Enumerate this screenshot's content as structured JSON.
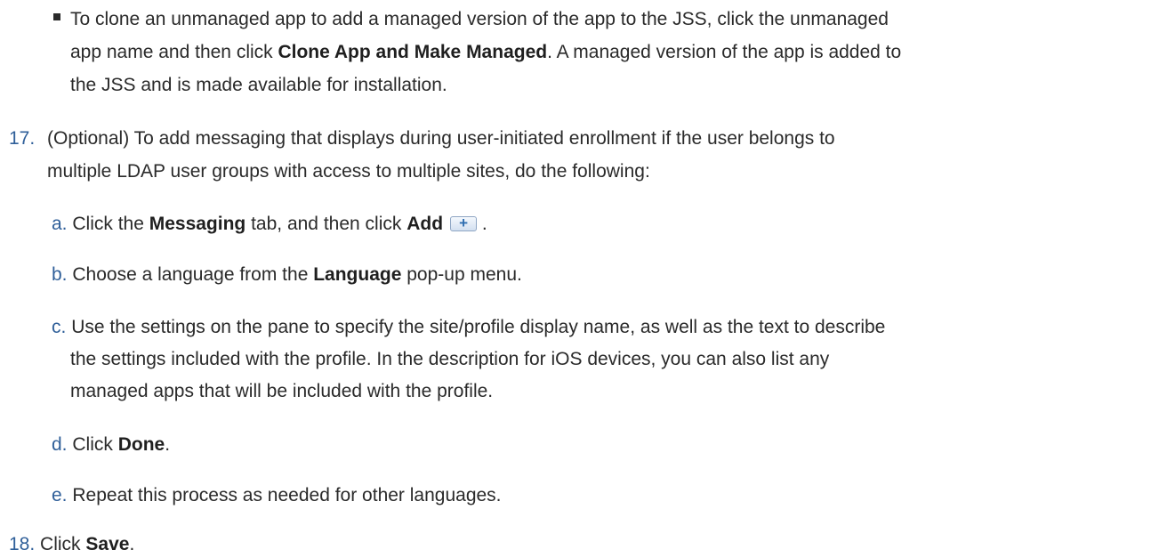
{
  "bullet_item": {
    "line1_pre": "To clone an unmanaged app to add a managed version of the app to the JSS, click the unmanaged",
    "line2_pre": "app name and then click ",
    "line2_bold": "Clone App and Make Managed",
    "line2_post": ". A managed version of the app is added to",
    "line3": "the JSS and is made available for installation."
  },
  "step17": {
    "number": "17.",
    "line1": "(Optional) To add messaging that displays during user-initiated enrollment if the user belongs to",
    "line2": "multiple LDAP user groups with access to multiple sites, do the following:",
    "substeps": {
      "a": {
        "letter": "a.",
        "pre": "Click the ",
        "bold1": "Messaging",
        "mid": " tab, and then click ",
        "bold2": "Add",
        "post": " ."
      },
      "b": {
        "letter": "b.",
        "pre": "Choose a language from the ",
        "bold": "Language",
        "post": " pop-up menu."
      },
      "c": {
        "letter": "c.",
        "line1": "Use the settings on the pane to specify the site/profile display name, as well as the text to describe",
        "line2": "the settings included with the profile. In the description for iOS devices, you can also list any",
        "line3": "managed apps that will be included with the profile."
      },
      "d": {
        "letter": "d.",
        "pre": "Click ",
        "bold": "Done",
        "post": "."
      },
      "e": {
        "letter": "e.",
        "text": "Repeat this process as needed for other languages."
      }
    }
  },
  "step18": {
    "number": "18.",
    "pre": "Click ",
    "bold": "Save",
    "post": "."
  },
  "icons": {
    "add_button_icon": "plus-icon",
    "add_button_glyph": "+"
  },
  "colors": {
    "text": "#2a2a2a",
    "step_number": "#2f5f99",
    "add_button_accent": "#2e6db0"
  }
}
